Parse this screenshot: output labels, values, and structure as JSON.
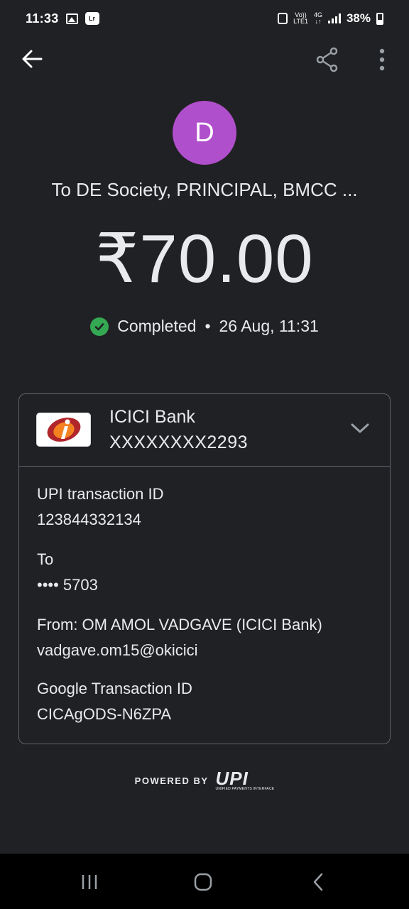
{
  "status_bar": {
    "time": "11:33",
    "network_top": "Vo))",
    "network_bottom": "LTE1",
    "network_type": "4G",
    "battery": "38%"
  },
  "app_bar": {
    "back_icon": "arrow-left-icon",
    "share_icon": "share-icon",
    "more_icon": "more-vert-icon"
  },
  "payee": {
    "initial": "D",
    "avatar_color": "#b04fcb",
    "name": "To DE Society, PRINCIPAL, BMCC ..."
  },
  "amount": "₹70.00",
  "status": {
    "label": "Completed",
    "separator": "•",
    "datetime": "26 Aug, 11:31",
    "color": "#34a853"
  },
  "bank": {
    "name": "ICICI Bank",
    "account": "XXXXXXXX2293",
    "logo_letter": "i"
  },
  "details": {
    "upi_id_label": "UPI transaction ID",
    "upi_id_value": "123844332134",
    "to_label": "To",
    "to_value": "•••• 5703",
    "from_label": "From: OM AMOL VADGAVE (ICICI Bank)",
    "from_value": "vadgave.om15@okicici",
    "google_id_label": "Google Transaction ID",
    "google_id_value": "CICAgODS-N6ZPA"
  },
  "footer": {
    "powered_by": "POWERED BY",
    "upi": "UPI",
    "upi_sub": "UNIFIED PAYMENTS INTERFACE"
  }
}
